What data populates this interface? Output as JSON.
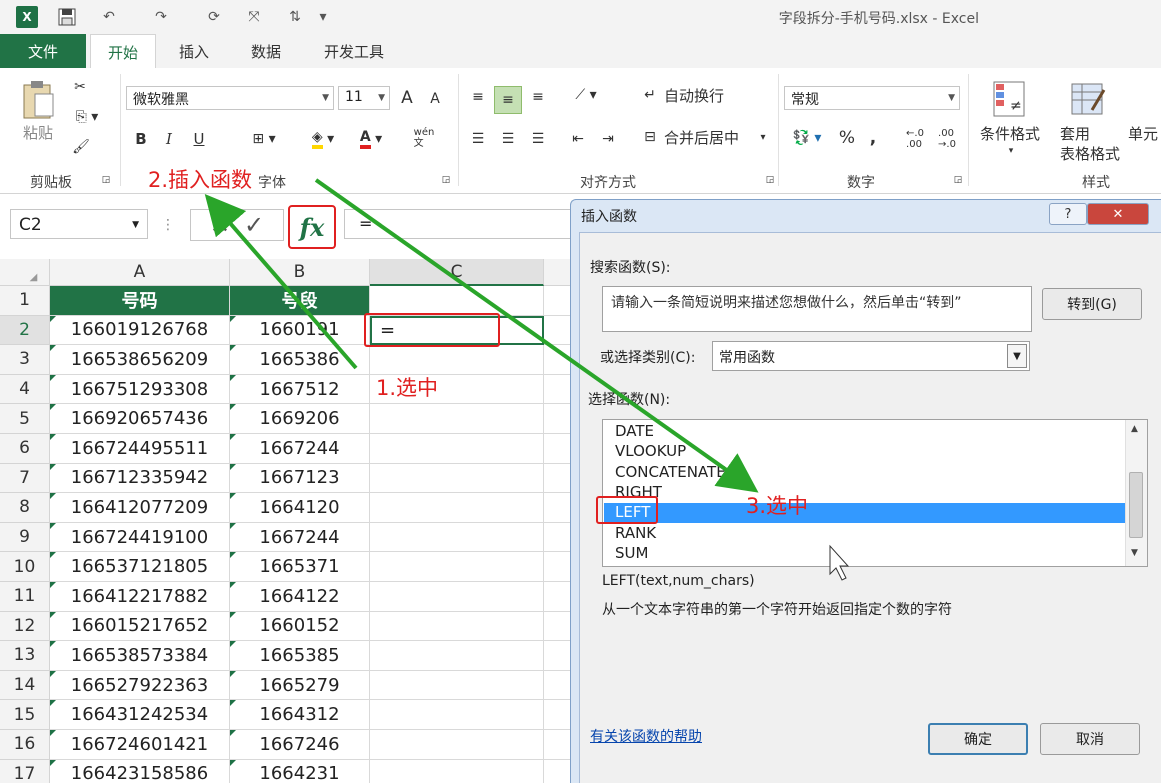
{
  "window": {
    "title": "字段拆分-手机号码.xlsx - Excel"
  },
  "tabs": [
    {
      "label": "文件"
    },
    {
      "label": "开始"
    },
    {
      "label": "插入"
    },
    {
      "label": "数据"
    },
    {
      "label": "开发工具"
    }
  ],
  "ribbon": {
    "clipboard": {
      "paste": "粘贴",
      "label": "剪贴板"
    },
    "font": {
      "name": "微软雅黑",
      "size": "11",
      "label": "字体",
      "bold": "B",
      "italic": "I",
      "underline": "U",
      "grow": "A",
      "shrink": "A",
      "wen": "wén\n文"
    },
    "alignment": {
      "wrap": "自动换行",
      "merge": "合并后居中",
      "label": "对齐方式"
    },
    "number": {
      "format": "常规",
      "percent": "%",
      "comma": ",",
      "label": "数字"
    },
    "styles": {
      "conditional": "条件格式",
      "table": "套用\n表格格式",
      "cell": "单元",
      "label": "样式"
    }
  },
  "formula_bar": {
    "name_box": "C2",
    "fx": "fx",
    "value": "="
  },
  "sheet": {
    "col_headers": [
      "A",
      "B",
      "C"
    ],
    "header_row": [
      "号码",
      "号段",
      ""
    ],
    "rows": [
      [
        "166019126768",
        "1660191",
        "="
      ],
      [
        "166538656209",
        "1665386",
        ""
      ],
      [
        "166751293308",
        "1667512",
        ""
      ],
      [
        "166920657436",
        "1669206",
        ""
      ],
      [
        "166724495511",
        "1667244",
        ""
      ],
      [
        "166712335942",
        "1667123",
        ""
      ],
      [
        "166412077209",
        "1664120",
        ""
      ],
      [
        "166724419100",
        "1667244",
        ""
      ],
      [
        "166537121805",
        "1665371",
        ""
      ],
      [
        "166412217882",
        "1664122",
        ""
      ],
      [
        "166015217652",
        "1660152",
        ""
      ],
      [
        "166538573384",
        "1665385",
        ""
      ],
      [
        "166527922363",
        "1665279",
        ""
      ],
      [
        "166431242534",
        "1664312",
        ""
      ],
      [
        "166724601421",
        "1667246",
        ""
      ],
      [
        "166423158586",
        "1664231",
        ""
      ]
    ]
  },
  "annotations": {
    "step1": "1.选中",
    "step2": "2.插入函数",
    "step3": "3.选中"
  },
  "dialog": {
    "title": "插入函数",
    "help": "?",
    "close": "✕",
    "search_label": "搜索函数(S):",
    "search_text": "请输入一条简短说明来描述您想做什么，然后单击“转到”",
    "go_button": "转到(G)",
    "category_label": "或选择类别(C):",
    "category_value": "常用函数",
    "select_label": "选择函数(N):",
    "functions": [
      "DATE",
      "VLOOKUP",
      "CONCATENATE",
      "RIGHT",
      "LEFT",
      "RANK",
      "SUM"
    ],
    "selected_index": 4,
    "signature": "LEFT(text,num_chars)",
    "description": "从一个文本字符串的第一个字符开始返回指定个数的字符",
    "help_link": "有关该函数的帮助",
    "ok": "确定",
    "cancel": "取消"
  }
}
